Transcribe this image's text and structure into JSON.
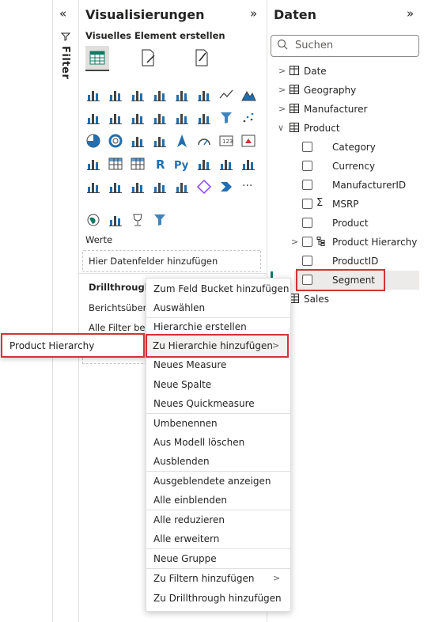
{
  "filter_pane": {
    "collapse_icon": "double-chevron-left-icon",
    "label": "Filter"
  },
  "viz_pane": {
    "title": "Visualisierungen",
    "subtitle": "Visuelles Element erstellen",
    "wells": {
      "values_label": "Werte",
      "values_placeholder": "Hier Datenfelder hinzufügen"
    },
    "drillthrough": {
      "title": "Drillthrough a",
      "cross_report": "Berichtsübergr",
      "keep_filters": "Alle Filter beib"
    }
  },
  "data_pane": {
    "title": "Daten",
    "search_placeholder": "Suchen",
    "tables": {
      "date": "Date",
      "geography": "Geography",
      "manufacturer": "Manufacturer",
      "product": "Product",
      "sales": "Sales"
    },
    "fields": {
      "category": "Category",
      "currency": "Currency",
      "manufacturerid": "ManufacturerID",
      "msrp": "MSRP",
      "product": "Product",
      "product_hierarchy": "Product Hierarchy",
      "productid": "ProductID",
      "segment": "Segment"
    }
  },
  "context_menu": {
    "items": [
      "Zum Feld Bucket hinzufügen",
      "Auswählen",
      "Hierarchie erstellen",
      "Zu Hierarchie hinzufügen",
      "Neues Measure",
      "Neue Spalte",
      "Neues Quickmeasure",
      "Umbenennen",
      "Aus Modell löschen",
      "Ausblenden",
      "Ausgeblendete anzeigen",
      "Alle einblenden",
      "Alle reduzieren",
      "Alle erweitern",
      "Neue Gruppe",
      "Zu Filtern hinzufügen",
      "Zu Drillthrough hinzufügen"
    ]
  },
  "submenu": {
    "item": "Product Hierarchy"
  },
  "colors": {
    "accent_red": "#d13438",
    "ms_blue": "#1f6fb2",
    "teal": "#117865"
  }
}
